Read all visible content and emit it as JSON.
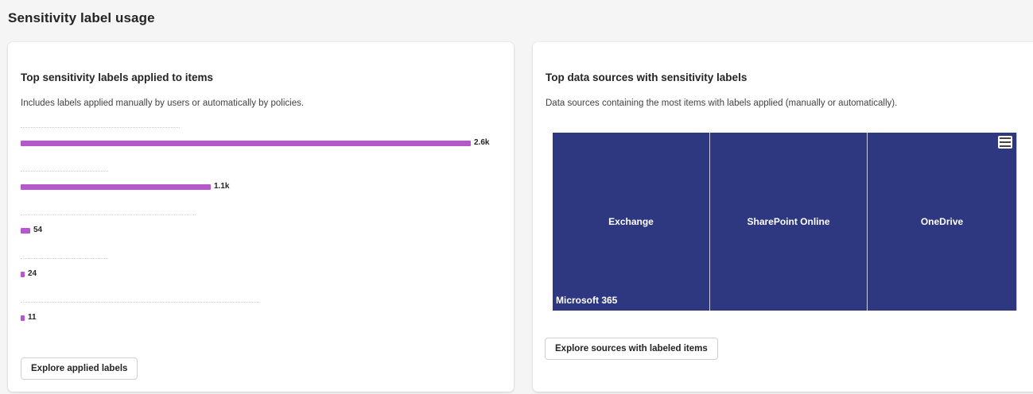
{
  "page": {
    "title": "Sensitivity label usage"
  },
  "left_card": {
    "title": "Top sensitivity labels applied to items",
    "description": "Includes labels applied manually by users or automatically by policies.",
    "bars": [
      {
        "value": 2600,
        "display": "2.6k"
      },
      {
        "value": 1100,
        "display": "1.1k"
      },
      {
        "value": 54,
        "display": "54"
      },
      {
        "value": 24,
        "display": "24"
      },
      {
        "value": 11,
        "display": "11"
      }
    ],
    "bar_color": "#b558cc",
    "button_label": "Explore applied labels"
  },
  "right_card": {
    "title": "Top data sources with sensitivity labels",
    "description": "Data sources containing the most items with labels applied (manually or automatically).",
    "treemap": {
      "group": "Microsoft 365",
      "color": "#2e3880",
      "tiles": [
        {
          "label": "Exchange"
        },
        {
          "label": "SharePoint Online"
        },
        {
          "label": "OneDrive"
        }
      ]
    },
    "menu_icon": "hamburger-menu-icon",
    "button_label": "Explore sources with labeled items"
  }
}
